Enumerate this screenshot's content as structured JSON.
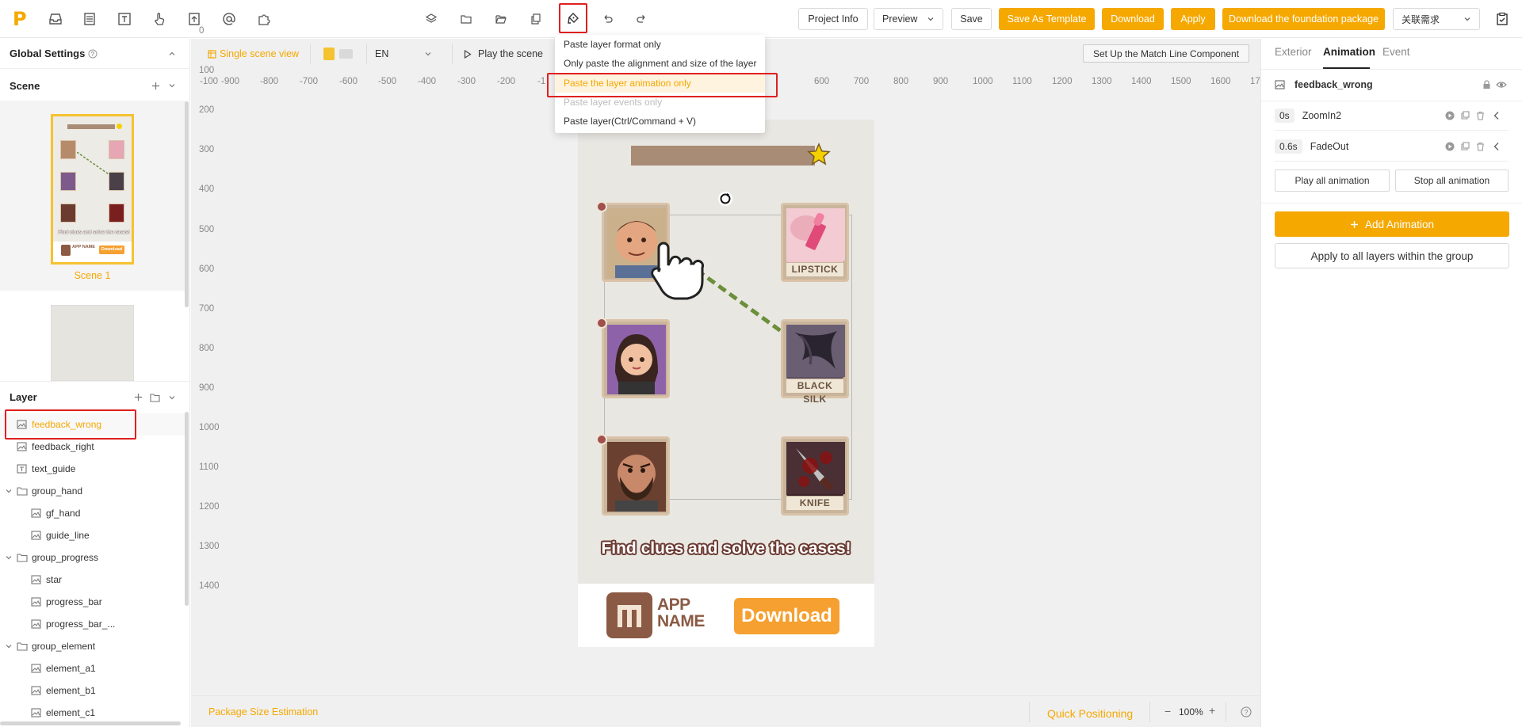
{
  "topbar": {
    "buttons": {
      "project_info": "Project Info",
      "preview": "Preview",
      "save": "Save",
      "save_template": "Save As Template",
      "download": "Download",
      "apply": "Apply",
      "download_foundation": "Download the foundation package",
      "related_requirements": "关联需求"
    }
  },
  "paste_menu": {
    "items": [
      {
        "label": "Paste layer format only"
      },
      {
        "label": "Only paste the alignment and size of the layer"
      },
      {
        "label": "Paste the layer animation only"
      },
      {
        "label": "Paste layer events only"
      },
      {
        "label": "Paste layer(Ctrl/Command + V)"
      }
    ]
  },
  "left_panel": {
    "global_settings": "Global Settings",
    "scene_header": "Scene",
    "scene1_label": "Scene 1",
    "layer_header": "Layer",
    "layers": [
      {
        "name": "feedback_wrong"
      },
      {
        "name": "feedback_right"
      },
      {
        "name": "text_guide"
      },
      {
        "name": "group_hand"
      },
      {
        "name": "gf_hand"
      },
      {
        "name": "guide_line"
      },
      {
        "name": "group_progress"
      },
      {
        "name": "star"
      },
      {
        "name": "progress_bar"
      },
      {
        "name": "progress_bar_..."
      },
      {
        "name": "group_element"
      },
      {
        "name": "element_a1"
      },
      {
        "name": "element_b1"
      },
      {
        "name": "element_c1"
      }
    ]
  },
  "canvas_toolbar": {
    "single_scene_view": "Single scene view",
    "language": "EN",
    "play_scene": "Play the scene",
    "match_line": "Set Up the Match Line Component"
  },
  "ruler": {
    "top": [
      "-100",
      "-900",
      "-800",
      "-700",
      "-600",
      "-500",
      "-400",
      "-300",
      "-200",
      "-1",
      "600",
      "700",
      "800",
      "900",
      "1000",
      "1100",
      "1200",
      "1300",
      "1400",
      "1500",
      "1600",
      "17"
    ],
    "left": [
      "0",
      "100",
      "200",
      "300",
      "400",
      "500",
      "600",
      "700",
      "800",
      "900",
      "1000",
      "1100",
      "1200",
      "1300",
      "1400"
    ]
  },
  "artboard": {
    "cards": [
      {
        "label": "LIPSTICK"
      },
      {
        "label": "BLACK SILK"
      },
      {
        "label": "KNIFE"
      }
    ],
    "headline": "Find clues and solve the cases!",
    "app_name_line1": "APP",
    "app_name_line2": "NAME",
    "download_btn": "Download",
    "thumb_headline": "Find clues and solve the cases!",
    "thumb_app": "APP NAME",
    "thumb_download": "Download"
  },
  "bottombar": {
    "package_size": "Package Size Estimation",
    "quick_positioning": "Quick Positioning",
    "zoom": "100%"
  },
  "right_panel": {
    "tabs": [
      "Exterior",
      "Animation",
      "Event"
    ],
    "layer_name": "feedback_wrong",
    "animations": [
      {
        "time": "0s",
        "name": "ZoomIn2"
      },
      {
        "time": "0.6s",
        "name": "FadeOut"
      }
    ],
    "play_all": "Play all animation",
    "stop_all": "Stop all animation",
    "add_animation": "Add Animation",
    "apply_group": "Apply to all layers within the group"
  },
  "colors": {
    "accent": "#f5a800",
    "highlight_border": "#e02020",
    "guide_line": "#6b8f3a"
  },
  "icons": [
    "inbox-icon",
    "layout-icon",
    "text-icon",
    "gesture-icon",
    "upload-icon",
    "at-icon",
    "puzzle-icon",
    "layers-icon",
    "folder-icon",
    "folder-open-icon",
    "copy-icon",
    "paste-format-icon",
    "undo-icon",
    "redo-icon",
    "checklist-icon",
    "lock-icon",
    "eye-icon",
    "help-icon"
  ]
}
